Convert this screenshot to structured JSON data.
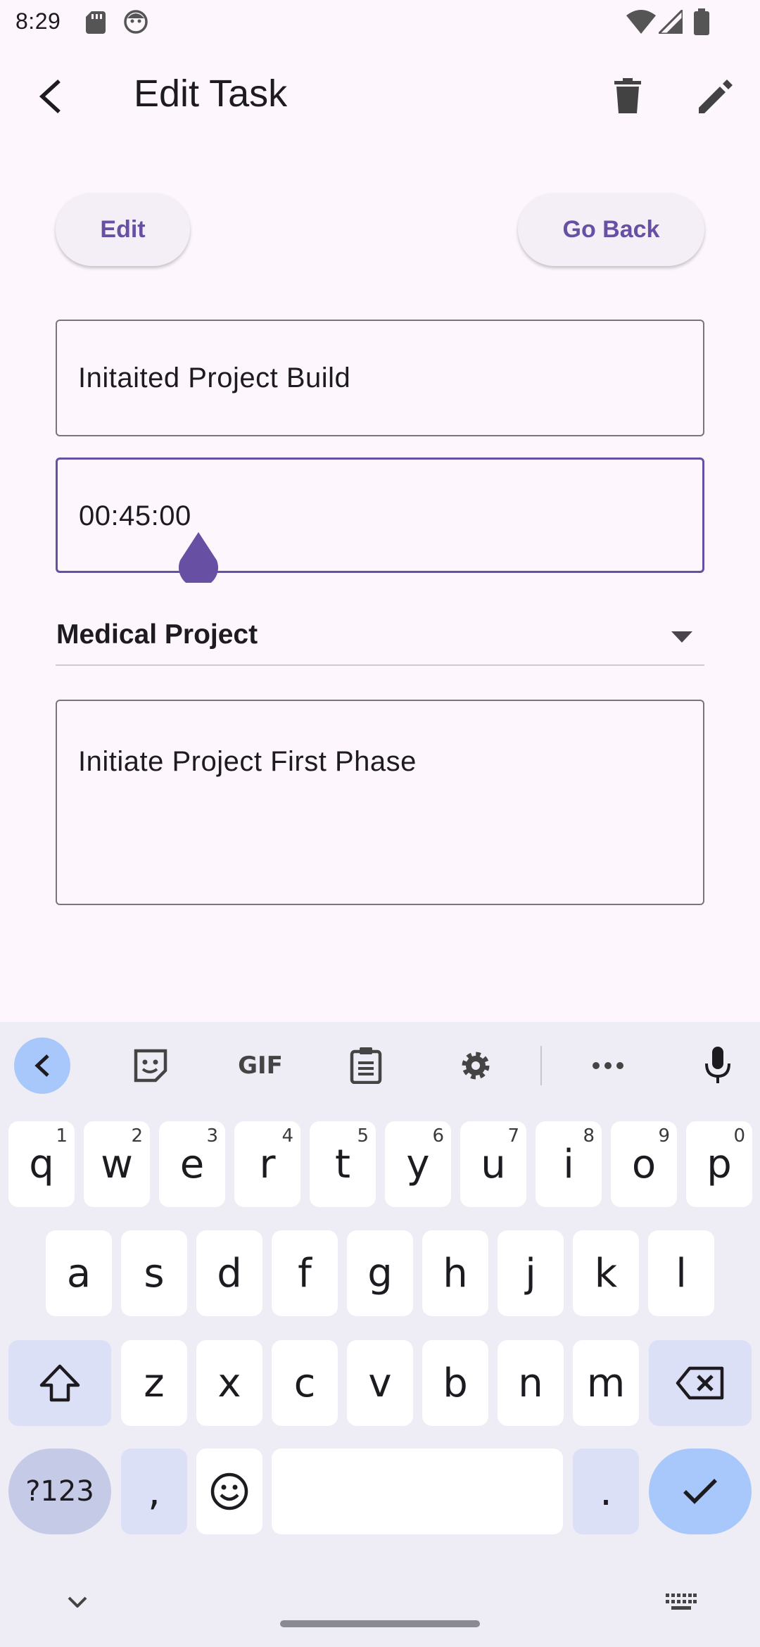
{
  "status_bar": {
    "time": "8:29"
  },
  "app_bar": {
    "title": "Edit Task"
  },
  "actions": {
    "edit_label": "Edit",
    "go_back_label": "Go Back"
  },
  "form": {
    "task_name": "Initaited Project Build",
    "duration": "00:45:00",
    "project": "Medical Project",
    "description": "Initiate Project First Phase"
  },
  "keyboard": {
    "toolbar": {
      "gif_label": "GIF"
    },
    "row1": [
      {
        "key": "q",
        "hint": "1"
      },
      {
        "key": "w",
        "hint": "2"
      },
      {
        "key": "e",
        "hint": "3"
      },
      {
        "key": "r",
        "hint": "4"
      },
      {
        "key": "t",
        "hint": "5"
      },
      {
        "key": "y",
        "hint": "6"
      },
      {
        "key": "u",
        "hint": "7"
      },
      {
        "key": "i",
        "hint": "8"
      },
      {
        "key": "o",
        "hint": "9"
      },
      {
        "key": "p",
        "hint": "0"
      }
    ],
    "row2": [
      "a",
      "s",
      "d",
      "f",
      "g",
      "h",
      "j",
      "k",
      "l"
    ],
    "row3": [
      "z",
      "x",
      "c",
      "v",
      "b",
      "n",
      "m"
    ],
    "bottom": {
      "symbols_label": "?123",
      "comma_label": ",",
      "period_label": "."
    }
  },
  "colors": {
    "accent": "#6750a4",
    "background": "#fdf7fd",
    "keyboard_bg": "#eeedf5",
    "action_key": "#a8c7fa"
  }
}
